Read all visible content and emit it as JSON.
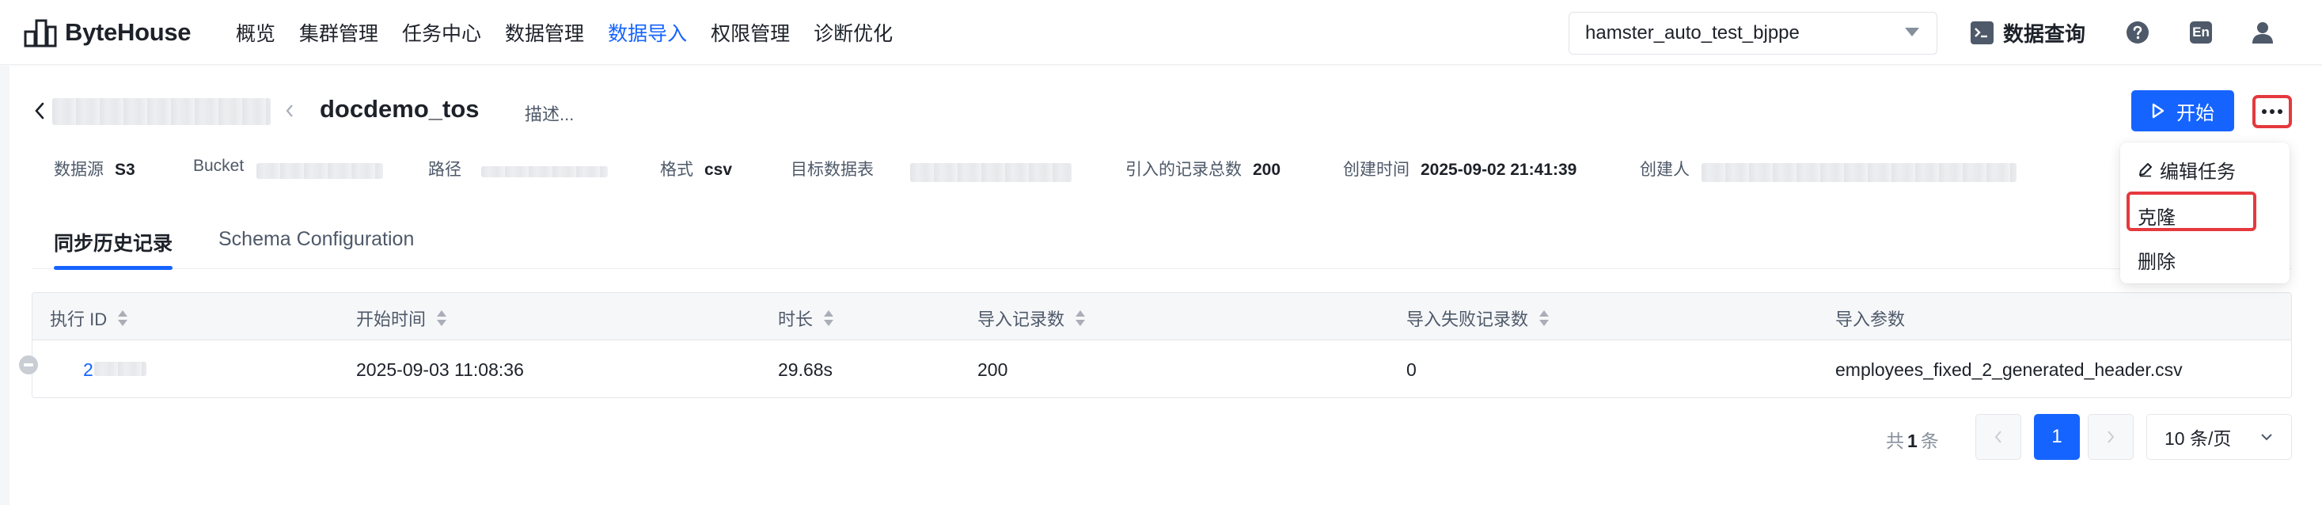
{
  "app": {
    "brand": "ByteHouse"
  },
  "nav": {
    "items": [
      {
        "label": "概览",
        "active": false
      },
      {
        "label": "集群管理",
        "active": false
      },
      {
        "label": "任务中心",
        "active": false
      },
      {
        "label": "数据管理",
        "active": false
      },
      {
        "label": "数据导入",
        "active": true
      },
      {
        "label": "权限管理",
        "active": false
      },
      {
        "label": "诊断优化",
        "active": false
      }
    ],
    "database_select": "hamster_auto_test_bjppe",
    "query_label": "数据查询",
    "lang_label": "En"
  },
  "header": {
    "title": "docdemo_tos",
    "description_placeholder": "描述...",
    "start_label": "开始"
  },
  "meta": {
    "source_label": "数据源",
    "source_value": "S3",
    "bucket_label": "Bucket",
    "path_label": "路径",
    "format_label": "格式",
    "format_value": "csv",
    "target_label": "目标数据表",
    "records_label": "引入的记录总数",
    "records_value": "200",
    "created_label": "创建时间",
    "created_value": "2025-09-02 21:41:39",
    "creator_label": "创建人"
  },
  "tabs": [
    {
      "label": "同步历史记录",
      "active": true
    },
    {
      "label": "Schema Configuration",
      "active": false
    }
  ],
  "table": {
    "columns": [
      "执行 ID",
      "开始时间",
      "时长",
      "导入记录数",
      "导入失败记录数",
      "导入参数"
    ],
    "rows": [
      {
        "run_id": "2",
        "start_time": "2025-09-03 11:08:36",
        "duration": "29.68s",
        "imported": "200",
        "failed": "0",
        "params": "employees_fixed_2_generated_header.csv"
      }
    ]
  },
  "pagination": {
    "total_prefix": "共",
    "total_count": "1",
    "total_suffix": "条",
    "current_page": "1",
    "page_size": "10 条/页"
  },
  "dropdown": {
    "items": [
      "编辑任务",
      "克隆",
      "删除"
    ]
  },
  "colors": {
    "accent": "#1664ff",
    "highlight": "#e5393e"
  }
}
